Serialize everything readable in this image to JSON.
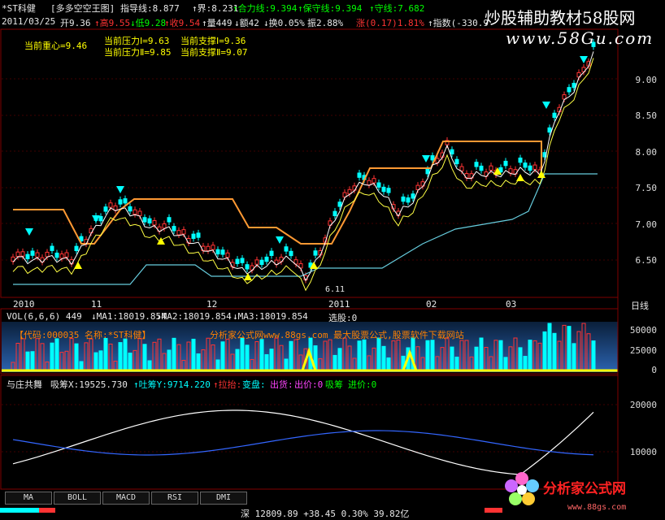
{
  "header": {
    "stock": "*ST科健",
    "formula": "[多多空空王图]",
    "indicator": "指导线:8.877",
    "jie": "↑界:8.231",
    "heli": "↑合力线:9.394",
    "baoshou": "↑保守线:9.394",
    "shou": "↑守线:7.682"
  },
  "quote": {
    "date": "2011/03/25",
    "open": "开9.36",
    "high": "↑高9.55",
    "low": "↓低9.28",
    "close": "↑收9.54",
    "vol": "↑量449",
    "amount": "↓额42",
    "turn": "↓换0.05%",
    "amp": "振2.88%",
    "change": "涨(0.17)1.81%",
    "index": "↑指数(-330.9"
  },
  "watermark": {
    "line1": "炒股辅助教材58股网",
    "line2": "www.58Gu.com"
  },
  "main_panel": {
    "center_line": "当前重心=9.46",
    "press1": "当前压力Ⅰ=9.63",
    "support1": "当前支撑Ⅰ=9.36",
    "press2": "当前压力Ⅱ=9.85",
    "support2": "当前支撑Ⅱ=9.07",
    "price_axis": [
      "9.00",
      "8.50",
      "8.00",
      "7.50",
      "7.00",
      "6.50"
    ],
    "low_marker": "6.11",
    "month_labels": [
      "2010",
      "11",
      "12",
      "2011",
      "02",
      "03"
    ],
    "period": "日线"
  },
  "vol_panel": {
    "title": "VOL(6,6,6) 449",
    "ma1": "↓MA1:18019.854",
    "ma2": "↓MA2:18019.854",
    "ma3": "↓MA3:18019.854",
    "select": "选股:0",
    "code_line": "【代码:000035 名称:*ST科健】",
    "site_line": "分析家公式网www.88gs.com 最大股票公式,股票软件下载网站",
    "axis": [
      "50000",
      "25000",
      "0"
    ]
  },
  "ind_panel": {
    "name": "与庄共舞",
    "xichou": "吸筹X:19525.730",
    "tuchou": "↑吐筹Y:9714.220",
    "lasheng": "↑拉抬:",
    "biandong": "变盘:",
    "chuhuo": "出货:",
    "chujia": "出价:0",
    "xichou2": "吸筹",
    "jinjia": "进价:0",
    "axis": [
      "20000",
      "10000"
    ]
  },
  "tabs": [
    "MA",
    "BOLL",
    "MACD",
    "RSI",
    "DMI"
  ],
  "statusbar": {
    "text": "深 12809.89 +38.45 0.30% 39.82亿"
  },
  "logo": {
    "text": "分析家公式网",
    "url": "www.88gs.com"
  },
  "colors": {
    "up": "#ff3333",
    "down": "#00ffff",
    "yellow": "#ffff00",
    "orange": "#ff9933",
    "white": "#ffffff",
    "blue": "#3366ff"
  }
}
